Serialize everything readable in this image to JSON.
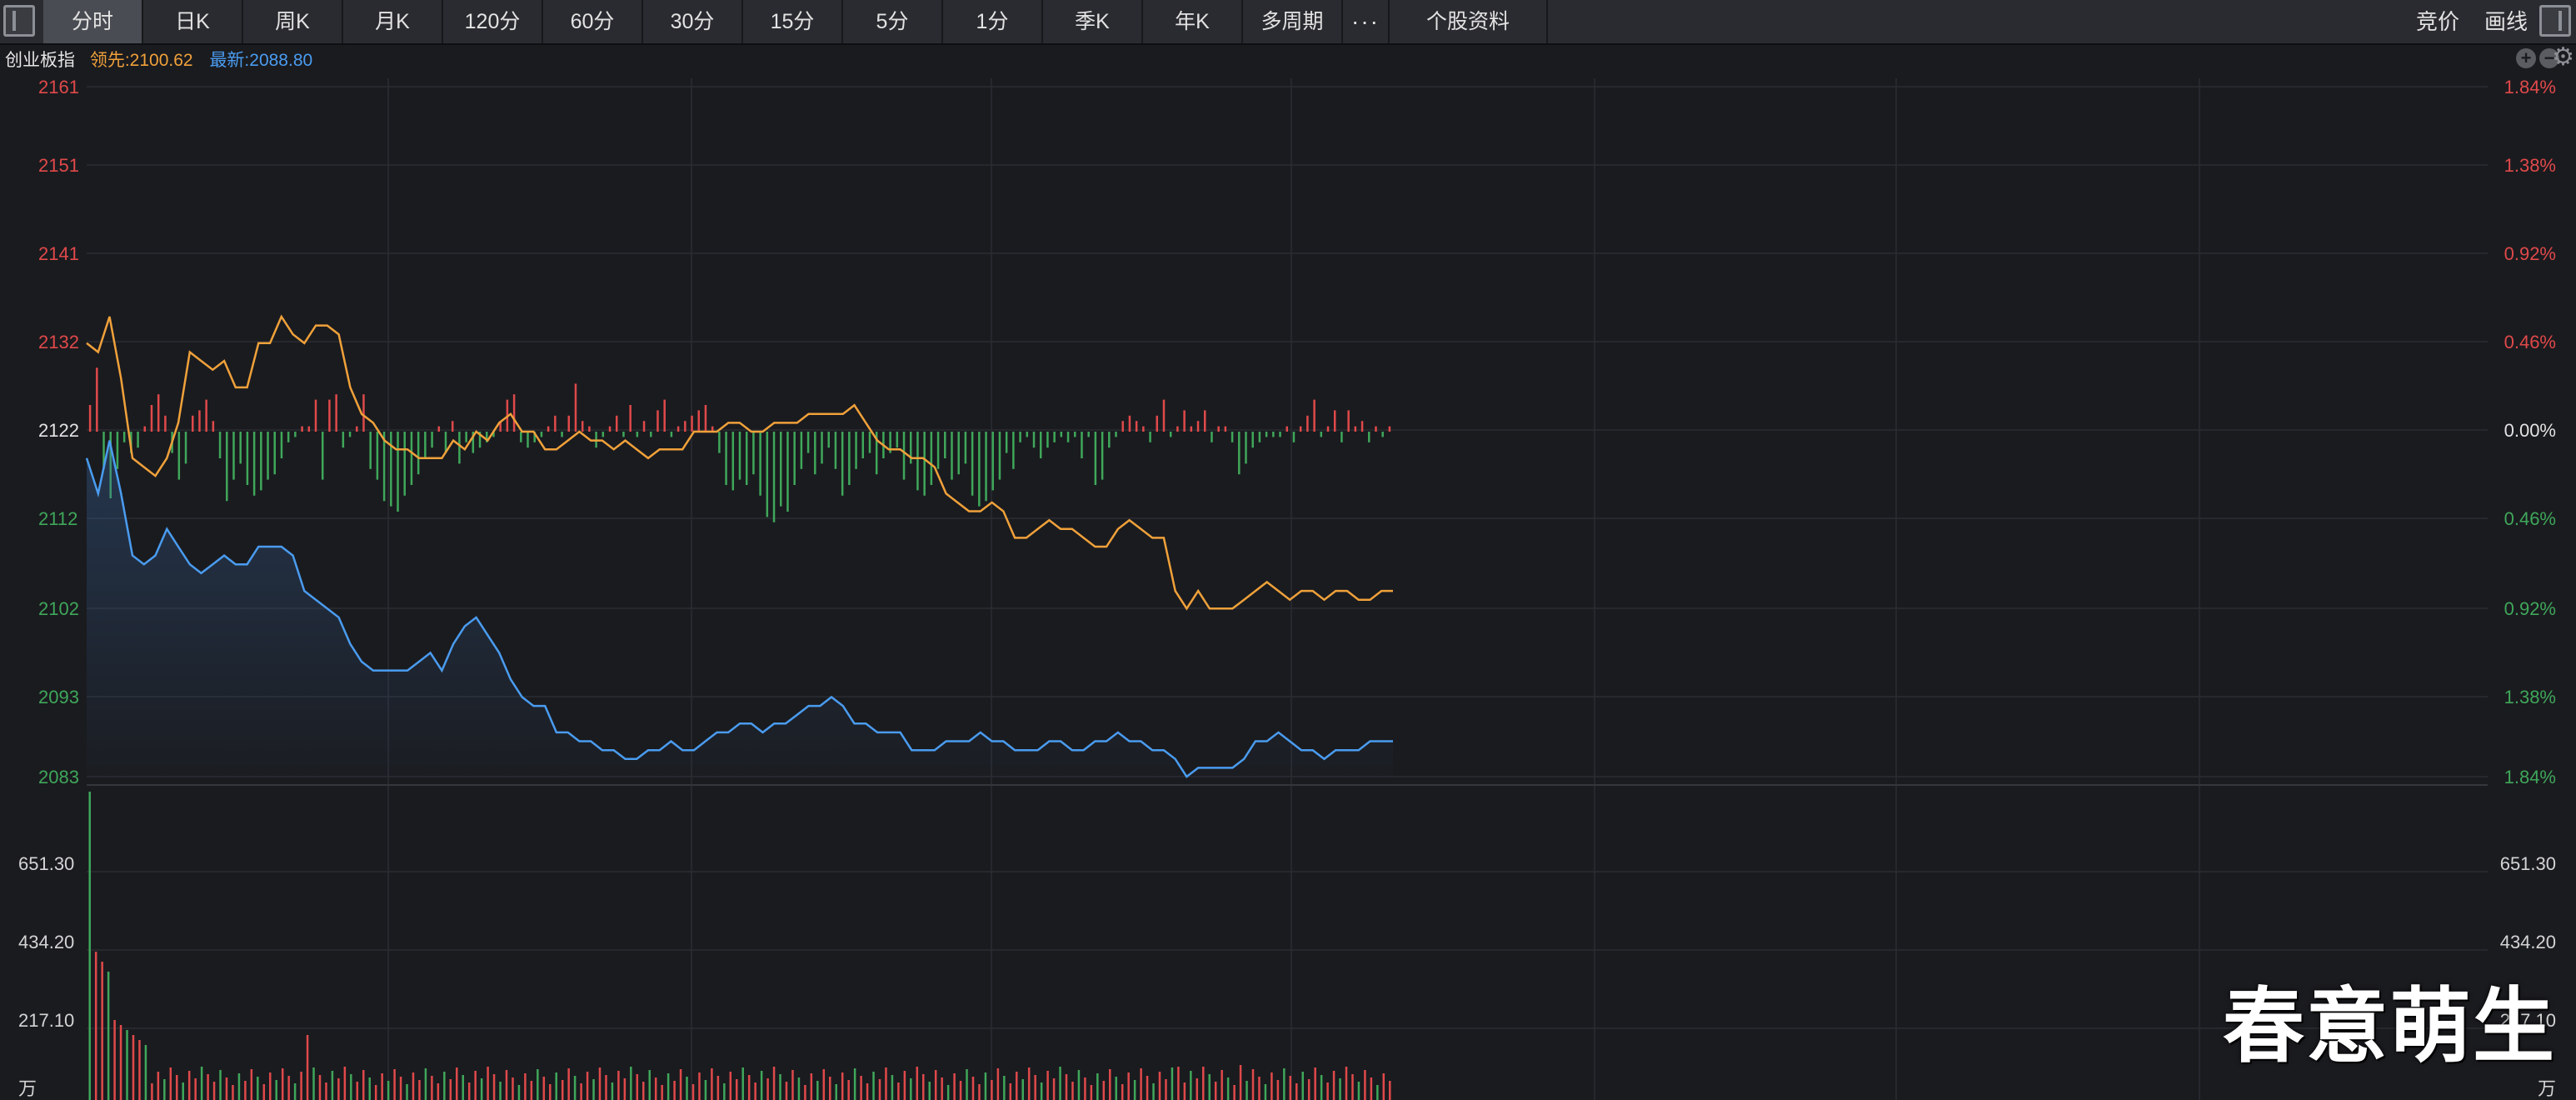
{
  "toolbar": {
    "tabs": [
      "分时",
      "日K",
      "周K",
      "月K",
      "120分",
      "60分",
      "30分",
      "15分",
      "5分",
      "1分",
      "季K",
      "年K",
      "多周期",
      "···",
      "个股资料"
    ],
    "active_tab": 0,
    "right": [
      "竞价",
      "画线"
    ]
  },
  "info": {
    "name": "创业板指",
    "lead": "领先:2100.62",
    "latest": "最新:2088.80"
  },
  "colors": {
    "up": "#e0494a",
    "down": "#3fa75a",
    "lead_line": "#f0a13a",
    "price_line": "#4a9cf0",
    "grid": "#2b2d33",
    "background": "#1a1b1f"
  },
  "watermark": "春意萌生",
  "chart_data": {
    "type": "line",
    "price_ticks": [
      2161,
      2151,
      2141,
      2132,
      2122,
      2112,
      2102,
      2093,
      2083
    ],
    "percent_ticks": [
      "1.84%",
      "1.38%",
      "0.92%",
      "0.46%",
      "0.00%",
      "0.46%",
      "0.92%",
      "1.38%",
      "1.84%"
    ],
    "volume_ticks": [
      "651.30",
      "434.20",
      "217.10",
      "万"
    ],
    "base_price": 2122,
    "series": [
      {
        "name": "领先",
        "color": "#f0a13a",
        "values": [
          2132,
          2131,
          2135,
          2128,
          2119,
          2118,
          2117,
          2119,
          2123,
          2131,
          2130,
          2129,
          2130,
          2127,
          2127,
          2132,
          2132,
          2135,
          2133,
          2132,
          2134,
          2134,
          2133,
          2127,
          2124,
          2123,
          2121,
          2120,
          2120,
          2119,
          2119,
          2119,
          2121,
          2120,
          2122,
          2121,
          2123,
          2124,
          2122,
          2122,
          2120,
          2120,
          2121,
          2122,
          2121,
          2121,
          2120,
          2121,
          2120,
          2119,
          2120,
          2120,
          2120,
          2122,
          2122,
          2122,
          2123,
          2123,
          2122,
          2122,
          2123,
          2123,
          2123,
          2124,
          2124,
          2124,
          2124,
          2125,
          2123,
          2121,
          2120,
          2120,
          2119,
          2119,
          2118,
          2115,
          2114,
          2113,
          2113,
          2114,
          2113,
          2110,
          2110,
          2111,
          2112,
          2111,
          2111,
          2110,
          2109,
          2109,
          2111,
          2112,
          2111,
          2110,
          2110,
          2104,
          2102,
          2104,
          2102,
          2102,
          2102,
          2103,
          2104,
          2105,
          2104,
          2103,
          2104,
          2104,
          2103,
          2104,
          2104,
          2103,
          2103,
          2104,
          2104
        ]
      },
      {
        "name": "最新",
        "color": "#4a9cf0",
        "values": [
          2119,
          2115,
          2121,
          2115,
          2108,
          2107,
          2108,
          2111,
          2109,
          2107,
          2106,
          2107,
          2108,
          2107,
          2107,
          2109,
          2109,
          2109,
          2108,
          2104,
          2103,
          2102,
          2101,
          2098,
          2096,
          2095,
          2095,
          2095,
          2095,
          2096,
          2097,
          2095,
          2098,
          2100,
          2101,
          2099,
          2097,
          2094,
          2092,
          2091,
          2091,
          2088,
          2088,
          2087,
          2087,
          2086,
          2086,
          2085,
          2085,
          2086,
          2086,
          2087,
          2086,
          2086,
          2087,
          2088,
          2088,
          2089,
          2089,
          2088,
          2089,
          2089,
          2090,
          2091,
          2091,
          2092,
          2091,
          2089,
          2089,
          2088,
          2088,
          2088,
          2086,
          2086,
          2086,
          2087,
          2087,
          2087,
          2088,
          2087,
          2087,
          2086,
          2086,
          2086,
          2087,
          2087,
          2086,
          2086,
          2087,
          2087,
          2088,
          2087,
          2087,
          2086,
          2086,
          2085,
          2083,
          2084,
          2084,
          2084,
          2084,
          2085,
          2087,
          2087,
          2088,
          2087,
          2086,
          2086,
          2085,
          2086,
          2086,
          2086,
          2087,
          2087,
          2087
        ]
      }
    ],
    "imbalance_bars": [
      10,
      24,
      -14,
      -25,
      -14,
      -4,
      -8,
      -6,
      2,
      10,
      14,
      6,
      -8,
      -18,
      -12,
      6,
      8,
      12,
      4,
      -10,
      -26,
      -18,
      -12,
      -20,
      -24,
      -22,
      -18,
      -16,
      -10,
      -4,
      -2,
      2,
      2,
      12,
      -18,
      12,
      14,
      -6,
      -2,
      2,
      14,
      -14,
      -18,
      -26,
      -28,
      -30,
      -24,
      -20,
      -16,
      -10,
      -6,
      2,
      -8,
      4,
      -12,
      -4,
      -8,
      -6,
      -4,
      -2,
      4,
      12,
      14,
      -4,
      -6,
      -4,
      -2,
      2,
      6,
      -2,
      6,
      18,
      4,
      2,
      -6,
      -2,
      2,
      6,
      -2,
      10,
      -2,
      4,
      -2,
      8,
      12,
      -2,
      2,
      4,
      6,
      8,
      10,
      2,
      -8,
      -20,
      -22,
      -18,
      -20,
      -16,
      -24,
      -32,
      -34,
      -28,
      -30,
      -20,
      -14,
      -8,
      -16,
      -12,
      -6,
      -14,
      -24,
      -20,
      -14,
      -10,
      -8,
      -16,
      -10,
      -8,
      -6,
      -18,
      -12,
      -22,
      -24,
      -20,
      -14,
      -10,
      -18,
      -16,
      -12,
      -24,
      -28,
      -26,
      -22,
      -18,
      -8,
      -14,
      -4,
      -2,
      -6,
      -10,
      -6,
      -4,
      -2,
      -4,
      -2,
      -10,
      -2,
      -20,
      -18,
      -6,
      -2,
      4,
      6,
      4,
      2,
      -4,
      6,
      12,
      -2,
      2,
      8,
      2,
      4,
      8,
      -4,
      2,
      2,
      -4,
      -16,
      -12,
      -6,
      -4,
      -2,
      -2,
      -2,
      2,
      -4,
      2,
      6,
      12,
      -2,
      2,
      8,
      -4,
      8,
      2,
      4,
      -4,
      2,
      -2,
      2
    ]
  }
}
